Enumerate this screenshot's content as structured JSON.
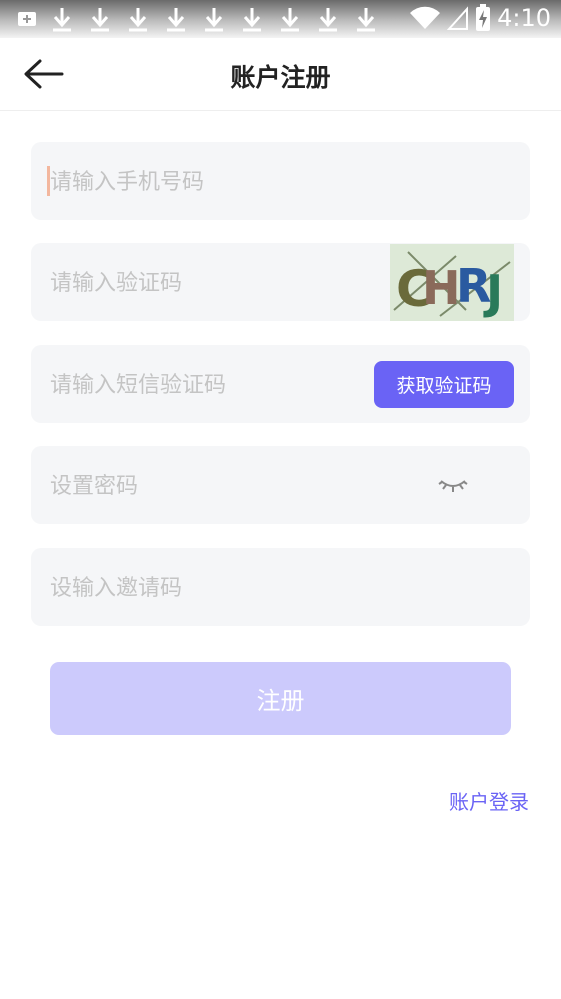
{
  "status_bar": {
    "time": "4:10",
    "icons": [
      "add-notification-icon",
      "download-icon",
      "download-icon",
      "download-icon",
      "download-icon",
      "download-icon",
      "download-icon",
      "download-icon",
      "download-icon",
      "download-icon",
      "wifi-icon",
      "signal-icon",
      "battery-charging-icon"
    ]
  },
  "header": {
    "title": "账户注册",
    "back_icon": "back-arrow-icon"
  },
  "form": {
    "phone_placeholder": "请输入手机号码",
    "captcha_placeholder": "请输入验证码",
    "captcha_text": "CHRJ",
    "sms_placeholder": "请输入短信验证码",
    "sms_button": "获取验证码",
    "password_placeholder": "设置密码",
    "password_toggle_icon": "eye-closed-icon",
    "invite_placeholder": "设输入邀请码"
  },
  "register_button": "注册",
  "login_link": "账户登录",
  "colors": {
    "accent": "#6a63f5",
    "register_disabled": "#cccafc",
    "field_bg": "#f5f6f8",
    "placeholder": "#c4c4c4"
  }
}
